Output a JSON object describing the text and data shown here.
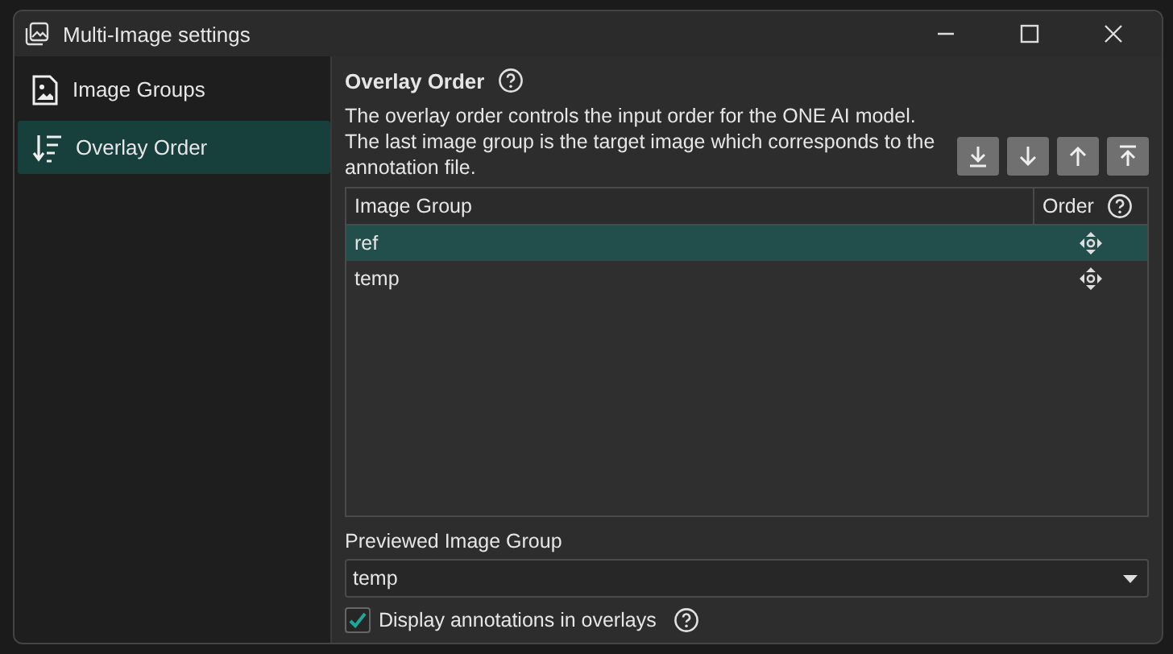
{
  "window": {
    "title": "Multi-Image settings"
  },
  "sidebar": {
    "items": [
      {
        "label": "Image Groups",
        "selected": false
      },
      {
        "label": "Overlay Order",
        "selected": true
      }
    ]
  },
  "section": {
    "title": "Overlay Order",
    "description_lines": [
      "The overlay order controls the input order for the ONE AI model.",
      "The last image group is the target image which corresponds to the annotation file."
    ]
  },
  "order_buttons": [
    {
      "kind": "bottom"
    },
    {
      "kind": "down"
    },
    {
      "kind": "up"
    },
    {
      "kind": "top"
    }
  ],
  "table": {
    "columns": [
      "Image Group",
      "Order"
    ],
    "rows": [
      {
        "name": "ref",
        "selected": true
      },
      {
        "name": "temp",
        "selected": false
      }
    ]
  },
  "preview": {
    "label": "Previewed Image Group",
    "value": "temp"
  },
  "annotations_checkbox": {
    "label": "Display annotations in overlays",
    "checked": true
  }
}
